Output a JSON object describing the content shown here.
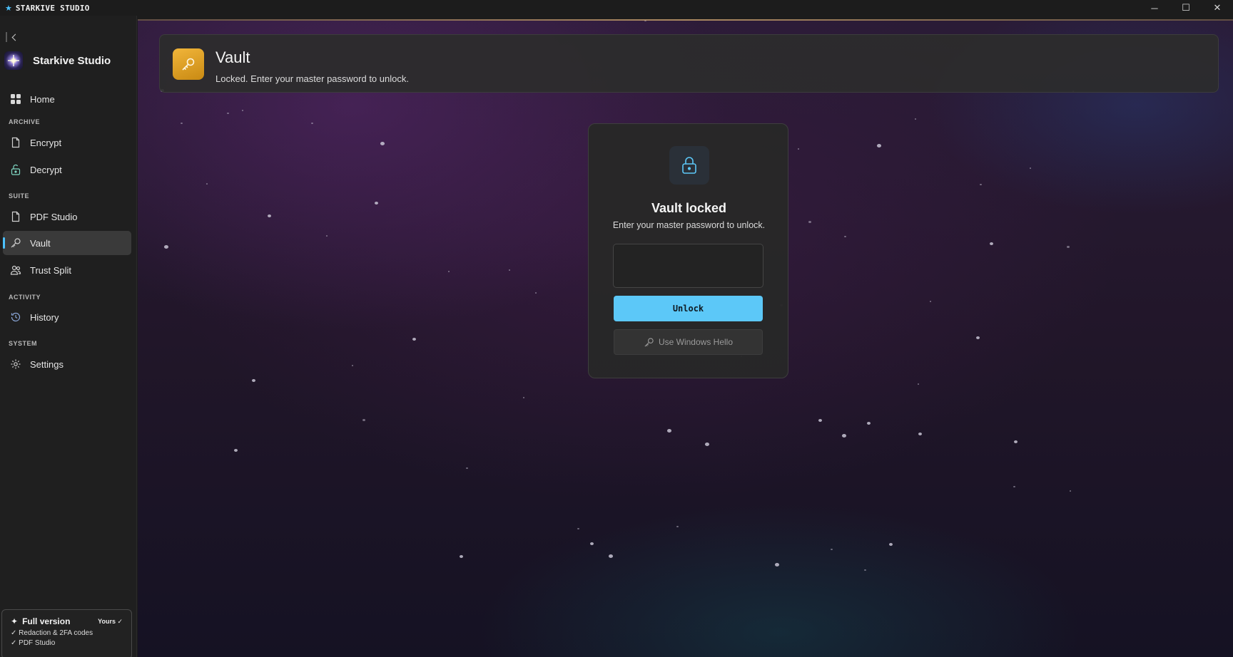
{
  "window": {
    "title": "STARKIVE STUDIO",
    "controls": {
      "minimize": "─",
      "maximize": "☐",
      "close": "✕"
    }
  },
  "sidebar": {
    "brand": "Starkive Studio",
    "home": {
      "label": "Home",
      "icon": "grid-icon"
    },
    "sections": {
      "archive": "ARCHIVE",
      "suite": "SUITE",
      "activity": "ACTIVITY",
      "system": "SYSTEM"
    },
    "items": {
      "encrypt": {
        "label": "Encrypt",
        "icon": "document-icon"
      },
      "decrypt": {
        "label": "Decrypt",
        "icon": "unlock-icon"
      },
      "pdf_studio": {
        "label": "PDF Studio",
        "icon": "document-icon"
      },
      "vault": {
        "label": "Vault",
        "icon": "key-icon",
        "active": true
      },
      "trust_split": {
        "label": "Trust Split",
        "icon": "people-icon"
      },
      "history": {
        "label": "History",
        "icon": "history-icon"
      },
      "settings": {
        "label": "Settings",
        "icon": "gear-icon"
      }
    },
    "license": {
      "title": "Full version",
      "badge": "Yours ✓",
      "features": [
        "✓ Redaction & 2FA codes",
        "✓ PDF Studio"
      ]
    }
  },
  "header": {
    "title": "Vault",
    "subtitle": "Locked. Enter your master password to unlock.",
    "icon": "key-icon"
  },
  "lock_panel": {
    "icon": "lock-icon",
    "title": "Vault locked",
    "subtitle": "Enter your master password to unlock.",
    "password_value": "",
    "unlock_label": "Unlock",
    "hello_label": "Use Windows Hello"
  },
  "colors": {
    "accent": "#4cc2ff",
    "unlock_button": "#5cc8f8",
    "vault_icon": "#e6a52a"
  }
}
